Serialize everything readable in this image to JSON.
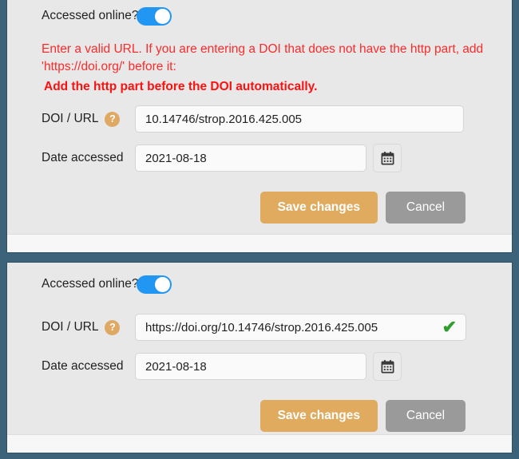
{
  "theme": {
    "page_background": "#3c6379",
    "panel_background": "#e8e8e8",
    "footer_background": "#f7f7f7",
    "error_color": "#fb2b2b",
    "toggle_on_color": "#2196f3",
    "help_badge_color": "#dfa964",
    "save_button_color": "#e0ab5e",
    "cancel_button_color": "#9a9a9a",
    "valid_check_color": "#2f9e2f"
  },
  "panels": [
    {
      "id": "invalid-state",
      "toggle": {
        "label": "Accessed online?",
        "state": "on"
      },
      "error": {
        "line1": "Enter a valid URL. If you are entering a DOI that does not have the http part, add 'https://doi.org/' before it:",
        "line2": "Add the http part before the DOI automatically."
      },
      "fields": {
        "doi": {
          "label": "DOI / URL",
          "help_icon": "?",
          "value": "10.14746/strop.2016.425.005",
          "placeholder": "DOI / URL",
          "valid": false
        },
        "date": {
          "label": "Date accessed",
          "value": "2021-08-18",
          "placeholder": "Date accessed",
          "calendar_icon": "calendar-icon"
        }
      },
      "buttons": {
        "save": "Save changes",
        "cancel": "Cancel"
      }
    },
    {
      "id": "valid-state",
      "toggle": {
        "label": "Accessed online?",
        "state": "on"
      },
      "error": null,
      "fields": {
        "doi": {
          "label": "DOI / URL",
          "help_icon": "?",
          "value": "https://doi.org/10.14746/strop.2016.425.005",
          "placeholder": "DOI / URL",
          "valid": true,
          "valid_mark": "✔"
        },
        "date": {
          "label": "Date accessed",
          "value": "2021-08-18",
          "placeholder": "Date accessed",
          "calendar_icon": "calendar-icon"
        }
      },
      "buttons": {
        "save": "Save changes",
        "cancel": "Cancel"
      }
    }
  ]
}
